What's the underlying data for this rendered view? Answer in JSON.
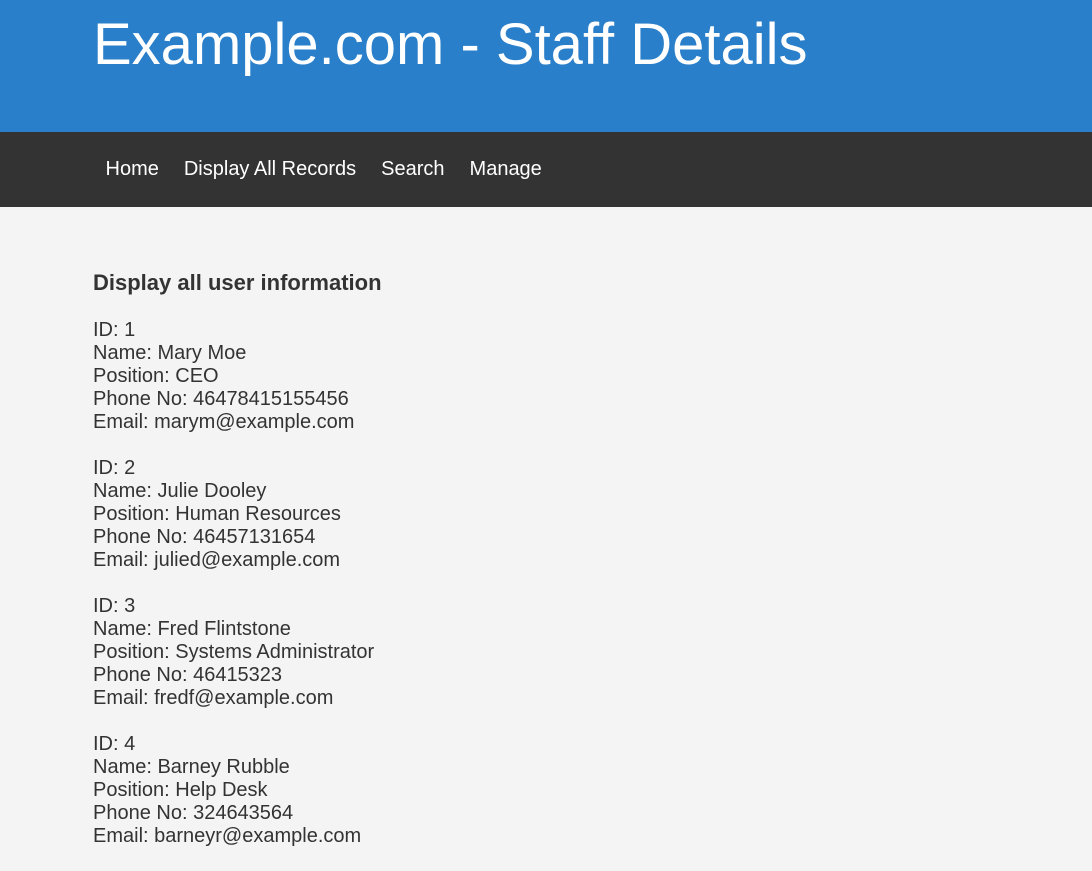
{
  "header": {
    "title": "Example.com - Staff Details"
  },
  "nav": {
    "items": [
      {
        "label": "Home"
      },
      {
        "label": "Display All Records"
      },
      {
        "label": "Search"
      },
      {
        "label": "Manage"
      }
    ]
  },
  "main": {
    "heading": "Display all user information",
    "records": [
      {
        "id": "ID: 1",
        "name": "Name: Mary Moe",
        "position": "Position: CEO",
        "phone": "Phone No: 46478415155456",
        "email": "Email: marym@example.com"
      },
      {
        "id": "ID: 2",
        "name": "Name: Julie Dooley",
        "position": "Position: Human Resources",
        "phone": "Phone No: 46457131654",
        "email": "Email: julied@example.com"
      },
      {
        "id": "ID: 3",
        "name": "Name: Fred Flintstone",
        "position": "Position: Systems Administrator",
        "phone": "Phone No: 46415323",
        "email": "Email: fredf@example.com"
      },
      {
        "id": "ID: 4",
        "name": "Name: Barney Rubble",
        "position": "Position: Help Desk",
        "phone": "Phone No: 324643564",
        "email": "Email: barneyr@example.com"
      }
    ]
  },
  "colors": {
    "header_bg": "#2a7fca",
    "nav_bg": "#333333",
    "page_bg": "#f4f4f4",
    "text": "#333333"
  }
}
